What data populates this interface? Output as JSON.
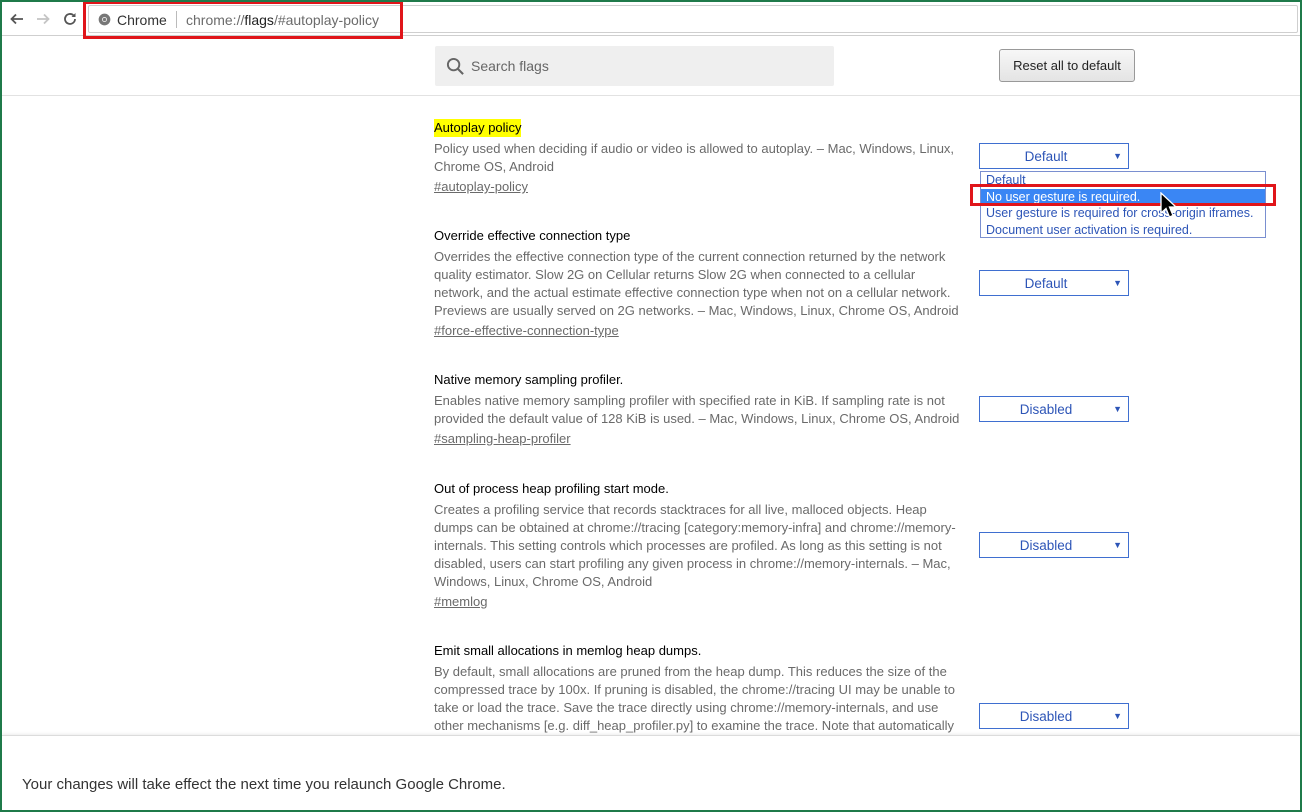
{
  "browser": {
    "omnibox_label": "Chrome",
    "url_prefix": "chrome://",
    "url_highlight": "flags",
    "url_suffix": "/#autoplay-policy"
  },
  "header": {
    "search_placeholder": "Search flags",
    "reset_label": "Reset all to default"
  },
  "experiments": [
    {
      "title": "Autoplay policy",
      "description": "Policy used when deciding if audio or video is allowed to autoplay. – Mac, Windows, Linux, Chrome OS, Android",
      "link": "#autoplay-policy",
      "value": "Default"
    },
    {
      "title": "Override effective connection type",
      "description": "Overrides the effective connection type of the current connection returned by the network quality estimator. Slow 2G on Cellular returns Slow 2G when connected to a cellular network, and the actual estimate effective connection type when not on a cellular network. Previews are usually served on 2G networks. – Mac, Windows, Linux, Chrome OS, Android",
      "link": "#force-effective-connection-type",
      "value": "Default"
    },
    {
      "title": "Native memory sampling profiler.",
      "description": "Enables native memory sampling profiler with specified rate in KiB. If sampling rate is not provided the default value of 128 KiB is used. – Mac, Windows, Linux, Chrome OS, Android",
      "link": "#sampling-heap-profiler",
      "value": "Disabled"
    },
    {
      "title": "Out of process heap profiling start mode.",
      "description": "Creates a profiling service that records stacktraces for all live, malloced objects. Heap dumps can be obtained at chrome://tracing [category:memory-infra] and chrome://memory-internals. This setting controls which processes are profiled. As long as this setting is not disabled, users can start profiling any given process in chrome://memory-internals. – Mac, Windows, Linux, Chrome OS, Android",
      "link": "#memlog",
      "value": "Disabled"
    },
    {
      "title": "Emit small allocations in memlog heap dumps.",
      "description": "By default, small allocations are pruned from the heap dump. This reduces the size of the compressed trace by 100x. If pruning is disabled, the chrome://tracing UI may be unable to take or load the trace. Save the trace directly using chrome://memory-internals, and use other mechanisms [e.g. diff_heap_profiler.py] to examine the trace. Note that automatically",
      "link": "",
      "value": "Disabled"
    }
  ],
  "dropdown": {
    "options": [
      "Default",
      "No user gesture is required.",
      "User gesture is required for cross-origin iframes.",
      "Document user activation is required."
    ],
    "highlighted": "No user gesture is required."
  },
  "footer": {
    "message": "Your changes will take effect the next time you relaunch Google Chrome."
  },
  "colors": {
    "highlight": "#ffff00",
    "annotation_box": "#e0151a",
    "select_text": "#2d55b7",
    "option_selected_bg": "#3a86f4"
  }
}
